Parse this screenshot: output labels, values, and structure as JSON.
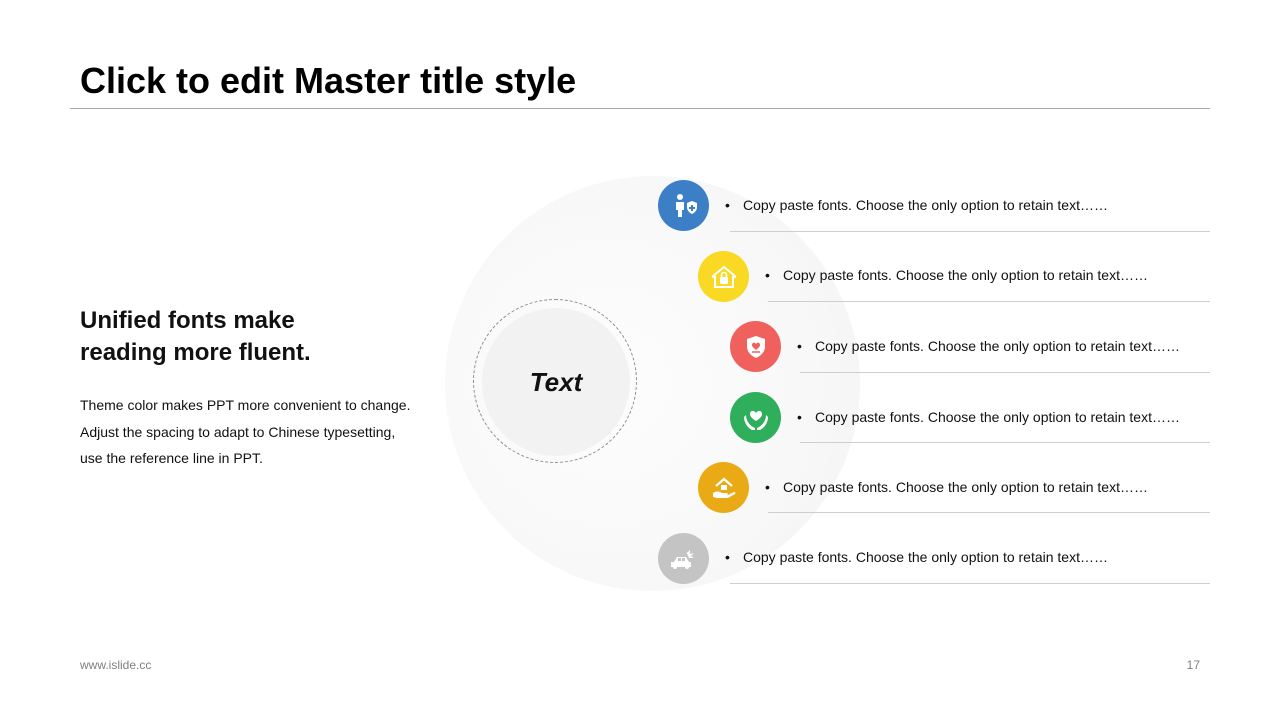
{
  "slide": {
    "title": "Click to edit Master title style",
    "heading_lines": [
      "Unified fonts make",
      "reading more fluent."
    ],
    "body_lines": [
      "Theme color makes PPT more convenient to change.",
      "Adjust the spacing to adapt to Chinese typesetting,",
      "use the reference line in PPT."
    ],
    "hub_label": "Text",
    "bullet": "•",
    "items": [
      {
        "text": "Copy paste fonts. Choose the only option to retain text……",
        "color": "#3d7fc6",
        "icon": "person-shield-icon"
      },
      {
        "text": "Copy paste fonts. Choose the only option to retain text……",
        "color": "#f9d924",
        "icon": "house-lock-icon"
      },
      {
        "text": "Copy paste fonts. Choose the only option to retain text……",
        "color": "#f0615e",
        "icon": "heart-shield-icon"
      },
      {
        "text": "Copy paste fonts. Choose the only option to retain text……",
        "color": "#2fae5c",
        "icon": "heart-hands-icon"
      },
      {
        "text": "Copy paste fonts. Choose the only option to retain text……",
        "color": "#e9aa16",
        "icon": "house-hand-icon"
      },
      {
        "text": "Copy paste fonts. Choose the only option to retain text……",
        "color": "#c4c4c4",
        "icon": "car-crash-icon"
      }
    ],
    "footer_left": "www.islide.cc",
    "page_number": "17"
  }
}
